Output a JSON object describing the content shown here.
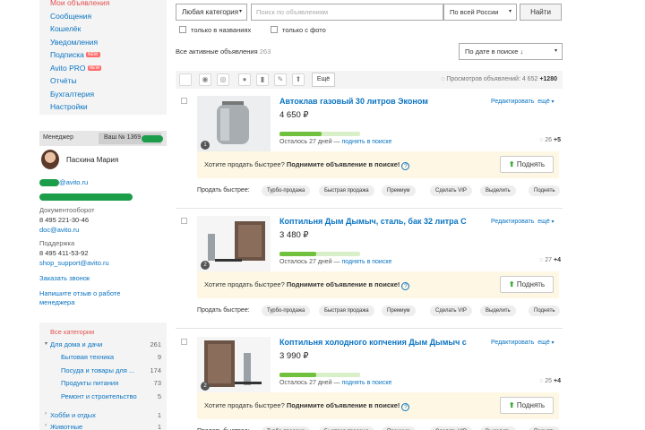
{
  "leftnav": {
    "items": [
      {
        "label": "Мои объявления",
        "active": true
      },
      {
        "label": "Сообщения"
      },
      {
        "label": "Кошелёк"
      },
      {
        "label": "Уведомления"
      },
      {
        "label": "Подписка",
        "badge": "NEW"
      },
      {
        "label": "Avito PRO",
        "badge": "NEW"
      },
      {
        "label": "Отчёты"
      },
      {
        "label": "Бухгалтерия"
      },
      {
        "label": "Настройки"
      }
    ]
  },
  "manager": {
    "tab_manager": "Менеджер",
    "tab_yours": "Ваш № 1369",
    "name": "Пасхина Мария",
    "email_suffix": "@avito.ru",
    "docflow_label": "Документооборот",
    "docflow_phone": "8 495 221-30-46",
    "docflow_email": "doc@avito.ru",
    "support_label": "Поддержка",
    "support_phone": "8 495 411-53-92",
    "support_email": "shop_support@avito.ru",
    "order_call": "Заказать звонок",
    "review": "Напишите отзыв о работе менеджера"
  },
  "categories": {
    "all": "Все категории",
    "home": {
      "label": "Для дома и дачи",
      "count": "261"
    },
    "subs": [
      {
        "label": "Бытовая техника",
        "count": "9"
      },
      {
        "label": "Посуда и товары для ...",
        "count": "174"
      },
      {
        "label": "Продукты питания",
        "count": "73"
      },
      {
        "label": "Ремонт и строительство",
        "count": "5"
      }
    ],
    "hobby": {
      "label": "Хобби и отдых",
      "count": "1"
    },
    "animals": {
      "label": "Животные",
      "count": "1"
    }
  },
  "search": {
    "category": "Любая категория",
    "placeholder": "Поиск по объявлениям",
    "region": "По всей России",
    "button": "Найти",
    "only_titles": "только в названиях",
    "only_photo": "только с фото"
  },
  "summary": {
    "all_active_label": "Все активные объявления",
    "all_active_count": "263"
  },
  "sort": {
    "selected": "По дате в поиске ↓"
  },
  "toolbar": {
    "more": "Ещё",
    "views_label": "Просмотров объявлений:",
    "views_count": "4 652",
    "views_new": "+1280"
  },
  "listing_common": {
    "edit": "Редактировать",
    "more": "ещё",
    "remaining": "Осталось 27 дней —",
    "raise_in_search": "поднять в поиске",
    "promo_text": "Хотите продать быстрее?",
    "promo_bold": "Поднимите объявление в поиске!",
    "promo_q": "?",
    "raise_button": "Поднять",
    "quick_label": "Продать быстрее:",
    "chips": [
      "Турбо-продажа",
      "Быстрая продажа",
      "Премиум",
      "Сделать VIP",
      "Выделить",
      "Поднять"
    ]
  },
  "listings": [
    {
      "title": "Автоклав газовый 30 литров Эконом",
      "price": "4 650 ₽",
      "photo_count": "1",
      "views": "26",
      "views_new": "+5",
      "progress": 0.52
    },
    {
      "title": "Коптильня Дым Дымыч, сталь, бак 32 литра С",
      "price": "3 480 ₽",
      "photo_count": "2",
      "views": "27",
      "views_new": "+4",
      "progress": 0.45
    },
    {
      "title": "Коптильня холодного копчения Дым Дымыч с",
      "price": "3 990 ₽",
      "photo_count": "2",
      "views": "25",
      "views_new": "+4",
      "progress": 0.45
    }
  ],
  "colors": {
    "link": "#0a74c2",
    "active": "#e35050",
    "green": "#1b9d4a",
    "promo_bg": "#fdf7e4",
    "progress": "#72c13e"
  }
}
